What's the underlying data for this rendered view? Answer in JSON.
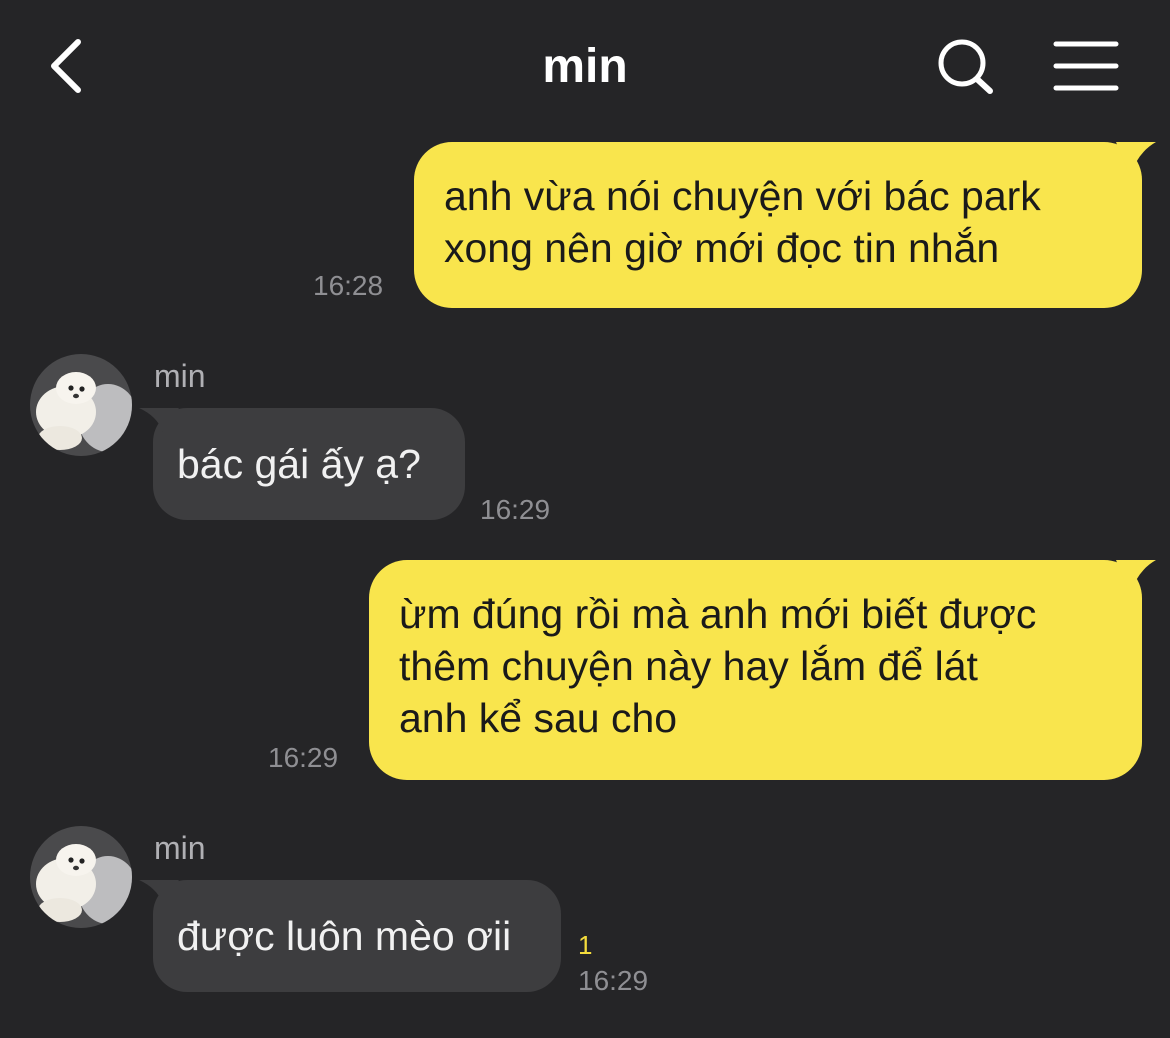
{
  "header": {
    "title": "min",
    "back_icon": "chevron-left-icon",
    "search_icon": "search-icon",
    "menu_icon": "hamburger-menu-icon"
  },
  "colors": {
    "background": "#252527",
    "outgoing_bubble": "#f9e54d",
    "incoming_bubble": "#3d3d3f",
    "timestamp": "#8f8f93",
    "unread": "#f4dc3c"
  },
  "messages": [
    {
      "direction": "outgoing",
      "lines": [
        "anh vừa nói chuyện với bác park",
        "xong nên giờ mới đọc tin nhắn"
      ],
      "time": "16:28"
    },
    {
      "direction": "incoming",
      "sender": "min",
      "lines": [
        "bác gái ấy ạ?"
      ],
      "time": "16:29"
    },
    {
      "direction": "outgoing",
      "lines": [
        "ừm đúng rồi mà anh mới biết được",
        "thêm chuyện này hay lắm để lát",
        "anh kể sau cho"
      ],
      "time": "16:29"
    },
    {
      "direction": "incoming",
      "sender": "min",
      "lines": [
        "được luôn mèo ơii"
      ],
      "unread": "1",
      "time": "16:29"
    }
  ]
}
